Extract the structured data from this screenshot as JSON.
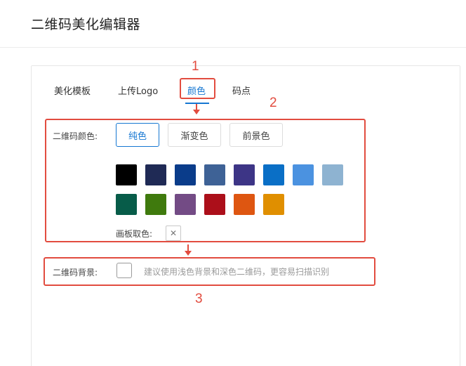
{
  "app": {
    "title": "二维码美化编辑器"
  },
  "tabs": [
    {
      "label": "美化模板",
      "active": false
    },
    {
      "label": "上传Logo",
      "active": false
    },
    {
      "label": "颜色",
      "active": true
    },
    {
      "label": "码点",
      "active": false
    }
  ],
  "annotations": {
    "n1": "1",
    "n2": "2",
    "n3": "3",
    "color": "#e24c3f"
  },
  "color_section": {
    "label": "二维码颜色:",
    "modes": [
      {
        "label": "纯色",
        "selected": true
      },
      {
        "label": "渐变色",
        "selected": false
      },
      {
        "label": "前景色",
        "selected": false
      }
    ],
    "swatches": [
      "#000000",
      "#1f2a55",
      "#0a3c8a",
      "#3e6296",
      "#3d3586",
      "#0a6fc6",
      "#4b92e0",
      "#8eb3d1",
      "#075c49",
      "#3f7a0d",
      "#734b85",
      "#ac0f1a",
      "#de5611",
      "#e08f00"
    ],
    "palette_label": "画板取色:",
    "palette_icon": "close-icon"
  },
  "background_section": {
    "label": "二维码背景:",
    "hint": "建议使用浅色背景和深色二维码，更容易扫描识别"
  },
  "theme": {
    "accent": "#1677d2"
  }
}
